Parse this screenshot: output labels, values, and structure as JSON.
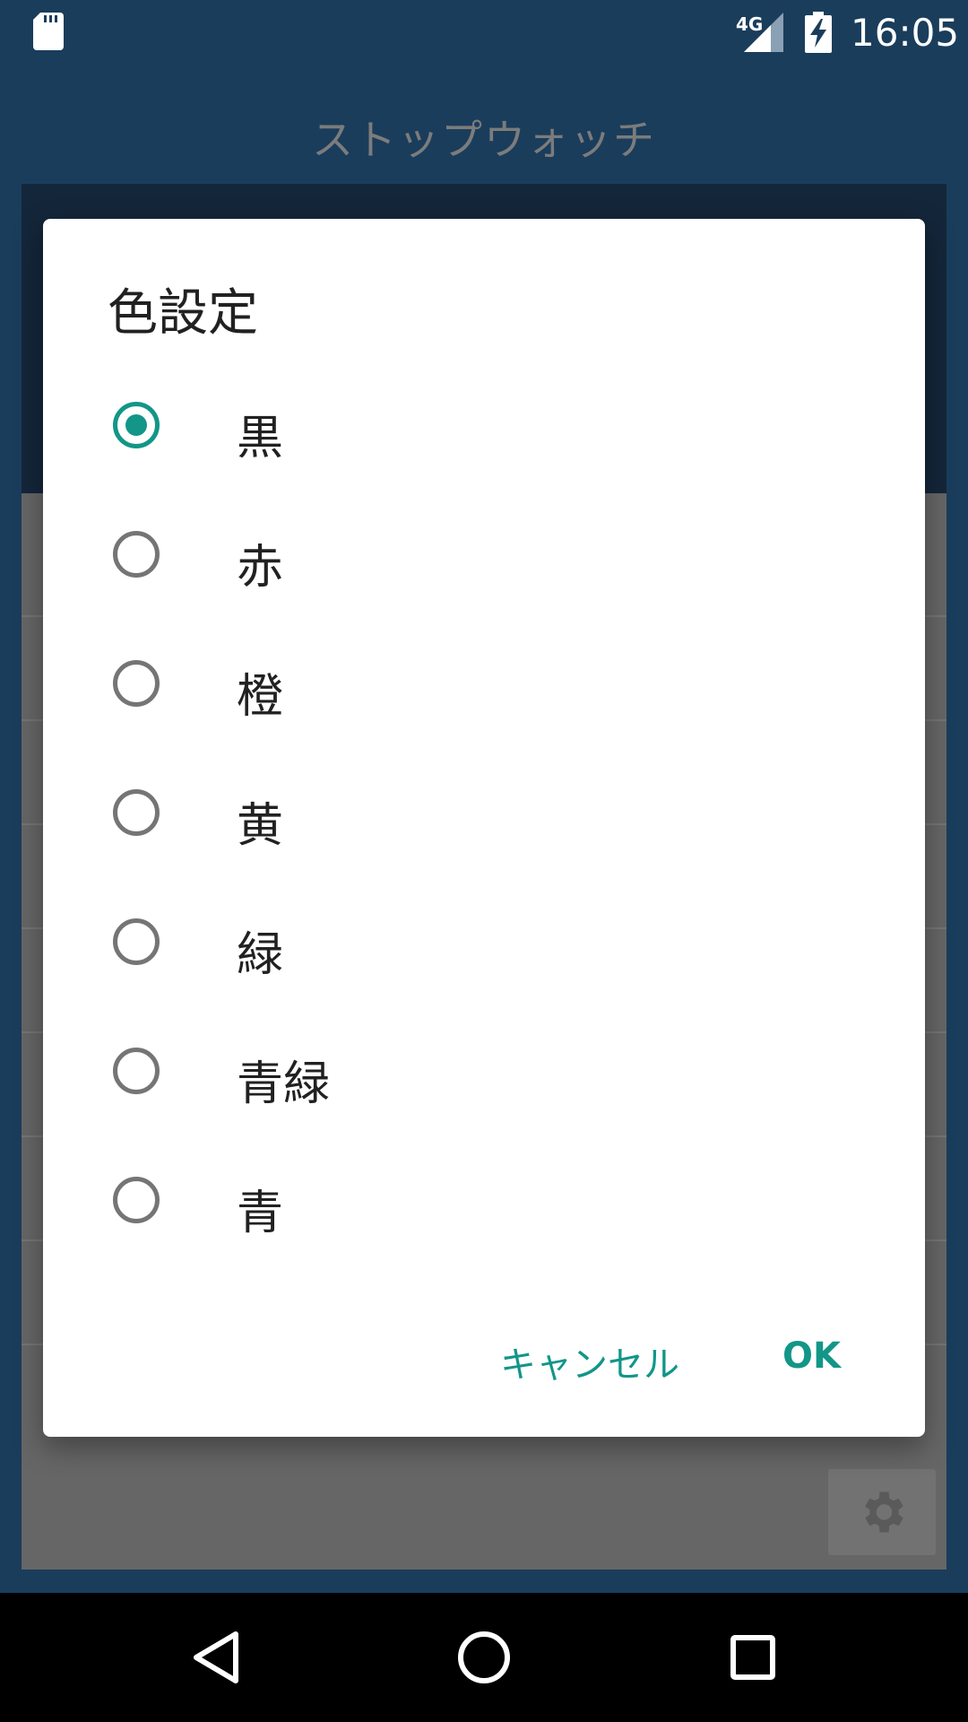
{
  "status_bar": {
    "time": "16:05",
    "network_type": "4G",
    "icons": [
      "sd-card-icon",
      "signal-icon",
      "battery-charging-icon"
    ]
  },
  "app": {
    "title": "ストップウォッチ",
    "settings_icon": "gear-icon"
  },
  "dialog": {
    "title": "色設定",
    "options": [
      {
        "label": "黒",
        "checked": true
      },
      {
        "label": "赤",
        "checked": false
      },
      {
        "label": "橙",
        "checked": false
      },
      {
        "label": "黄",
        "checked": false
      },
      {
        "label": "緑",
        "checked": false
      },
      {
        "label": "青緑",
        "checked": false
      },
      {
        "label": "青",
        "checked": false
      }
    ],
    "cancel_label": "キャンセル",
    "ok_label": "OK",
    "accent_color": "#129688"
  },
  "nav_bar": {
    "icons": [
      "back-icon",
      "home-icon",
      "recent-apps-icon"
    ]
  }
}
